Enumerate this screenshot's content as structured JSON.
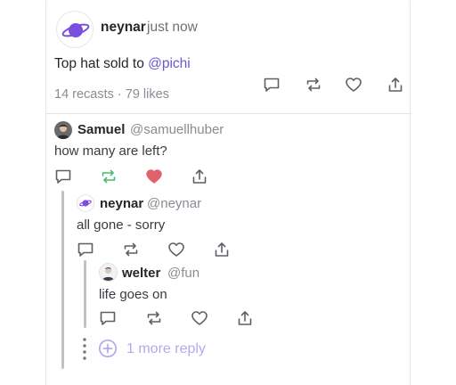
{
  "post": {
    "username": "neynar",
    "time": "just now",
    "text_prefix": "Top hat sold to ",
    "mention": "@pichi",
    "stats": "14 recasts · 79 likes",
    "avatar_icon": "planet-icon"
  },
  "replies": [
    {
      "name": "Samuel",
      "handle": "@samuellhuber",
      "text": "how many are left?",
      "recasted": true,
      "liked": true,
      "avatar_icon": "user-photo-avatar"
    },
    {
      "name": "neynar",
      "handle": "@neynar",
      "text": "all gone - sorry",
      "recasted": false,
      "liked": false,
      "avatar_icon": "planet-icon"
    },
    {
      "name": "welter",
      "handle": "@fun",
      "text": "life goes on",
      "recasted": false,
      "liked": false,
      "avatar_icon": "user-avatar"
    }
  ],
  "more_replies": {
    "label": "1 more reply",
    "icon": "plus-circle-icon"
  },
  "colors": {
    "accent_purple": "#6e56cf",
    "recast_active": "#3fbf6a",
    "like_active": "#e0626a",
    "icon_default": "#5f5f66",
    "more_reply": "#b7a7f0"
  }
}
